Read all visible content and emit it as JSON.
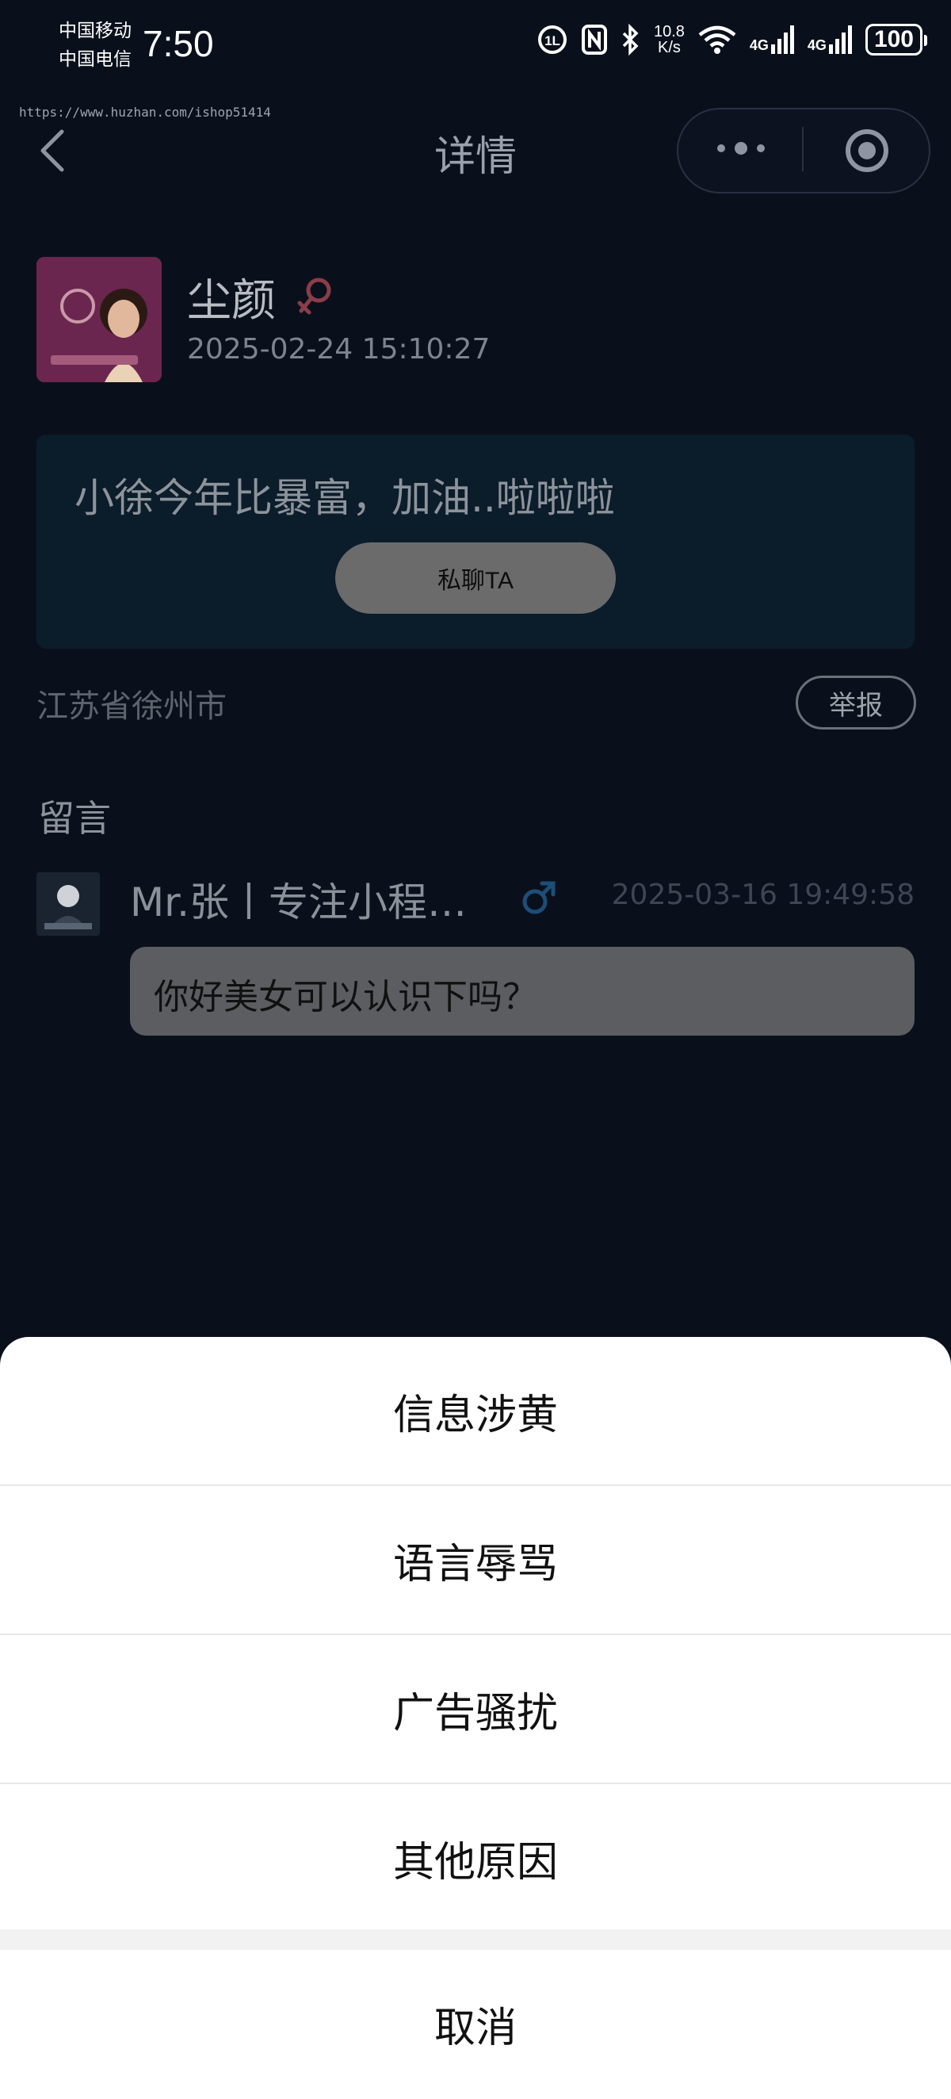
{
  "status_bar": {
    "carrier1": "中国移动",
    "carrier2": "中国电信",
    "time": "7:50",
    "speed_value": "10.8",
    "speed_unit": "K/s",
    "network1": "4G",
    "network2": "4G",
    "battery": "100"
  },
  "watermark": "https://www.huzhan.com/ishop51414",
  "nav": {
    "title": "详情"
  },
  "post": {
    "user_name": "尘颜",
    "gender": "female",
    "time": "2025-02-24 15:10:27",
    "content": "小徐今年比暴富，加油..啦啦啦",
    "chat_button": "私聊TA",
    "location": "江苏省徐州市",
    "report_button": "举报"
  },
  "comments": {
    "title": "留言",
    "items": [
      {
        "name": "Mr.张丨专注小程…",
        "gender": "male",
        "time": "2025-03-16 19:49:58",
        "text": "你好美女可以认识下吗？"
      }
    ]
  },
  "action_sheet": {
    "options": [
      "信息涉黄",
      "语言辱骂",
      "广告骚扰",
      "其他原因"
    ],
    "cancel": "取消"
  },
  "colors": {
    "female": "#b0485a",
    "male": "#2a6fb0",
    "overlay": "#0a101b"
  }
}
